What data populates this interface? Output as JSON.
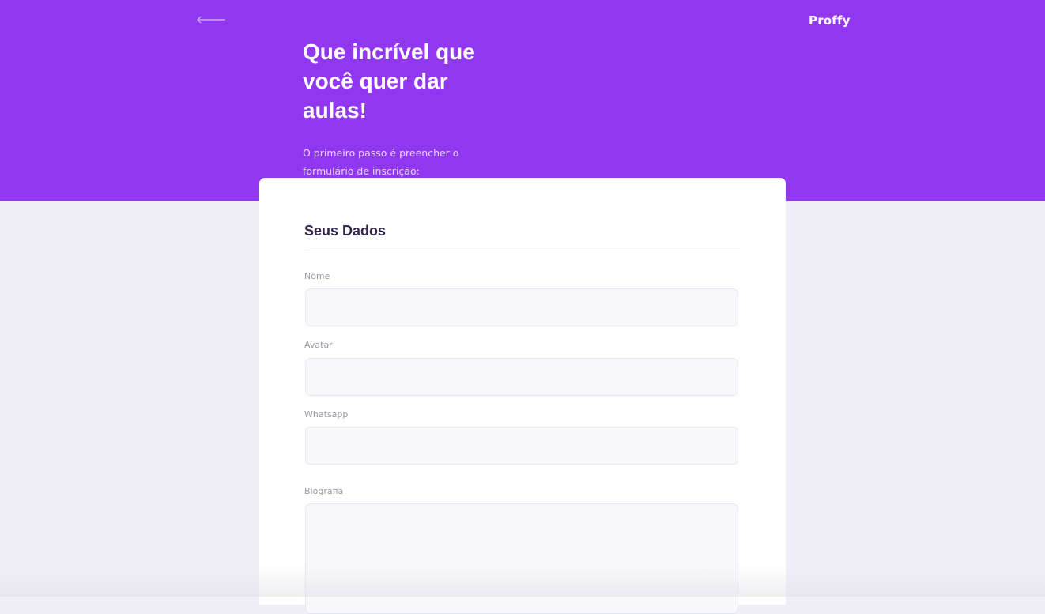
{
  "header": {
    "back_icon": "arrow-left-icon",
    "logo_text": "Proffy",
    "title": "Que incrível que você quer dar aulas!",
    "subtitle": "O primeiro passo é preencher o formulário de inscrição:"
  },
  "form": {
    "section_title": "Seus Dados",
    "fields": [
      {
        "label": "Nome",
        "value": ""
      },
      {
        "label": "Avatar",
        "value": ""
      },
      {
        "label": "Whatsapp",
        "value": ""
      },
      {
        "label": "Biografia",
        "value": ""
      }
    ]
  },
  "colors": {
    "primary": "#9237f0",
    "background": "#f0eff7",
    "title_text": "#32264d",
    "label_text": "#9c98a6",
    "input_background": "#f8f8fc",
    "input_border": "#e6e6f0"
  }
}
